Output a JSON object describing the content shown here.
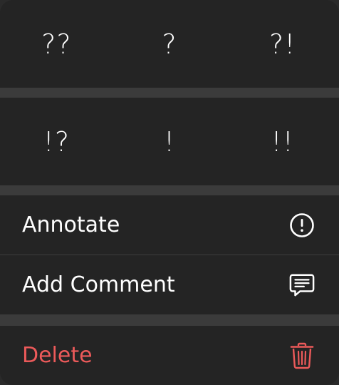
{
  "symbols": {
    "row1": [
      "??",
      "?",
      "?!"
    ],
    "row2": [
      "!?",
      "!",
      "!!"
    ]
  },
  "actions": {
    "annotate": {
      "label": "Annotate",
      "icon": "exclamation-circle-icon"
    },
    "add_comment": {
      "label": "Add Comment",
      "icon": "comment-bubble-icon"
    },
    "delete": {
      "label": "Delete",
      "icon": "trash-icon"
    }
  },
  "colors": {
    "background": "#242424",
    "separator": "#3b3b3b",
    "text": "#ffffff",
    "destructive": "#ec5a5a"
  }
}
